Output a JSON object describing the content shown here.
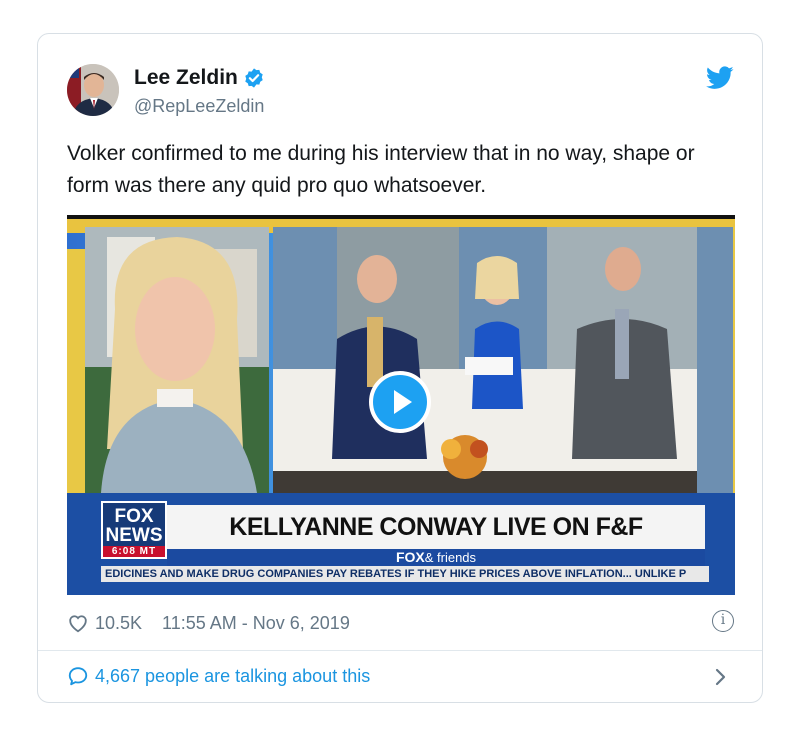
{
  "tweet": {
    "display_name": "Lee Zeldin",
    "handle": "@RepLeeZeldin",
    "verified": true,
    "text": "Volker confirmed to me during his interview that in no way, shape or form was there any quid pro quo whatsoever.",
    "likes": "10.5K",
    "timestamp": "11:55 AM - Nov 6, 2019",
    "talking": "4,667 people are talking about this"
  },
  "media": {
    "logo_line1": "FOX",
    "logo_line2": "NEWS",
    "logo_time": "6:08 MT",
    "headline": "KELLYANNE CONWAY LIVE ON F&F",
    "show_name_strong": "FOX",
    "show_name_rest": "& friends",
    "ticker": "EDICINES AND MAKE DRUG COMPANIES PAY REBATES IF THEY HIKE PRICES ABOVE INFLATION...   UNLIKE P"
  },
  "icons": {
    "brand": "twitter-bird-icon",
    "verified": "verified-badge-icon",
    "like": "heart-icon",
    "info": "info-icon",
    "reply": "speech-bubble-icon",
    "chevron": "chevron-right-icon",
    "play": "play-icon"
  },
  "colors": {
    "twitter_blue": "#1da1f2",
    "link_blue": "#1b95e0",
    "secondary_text": "#657786",
    "fox_blue": "#163a78",
    "fox_red": "#c8102e"
  }
}
